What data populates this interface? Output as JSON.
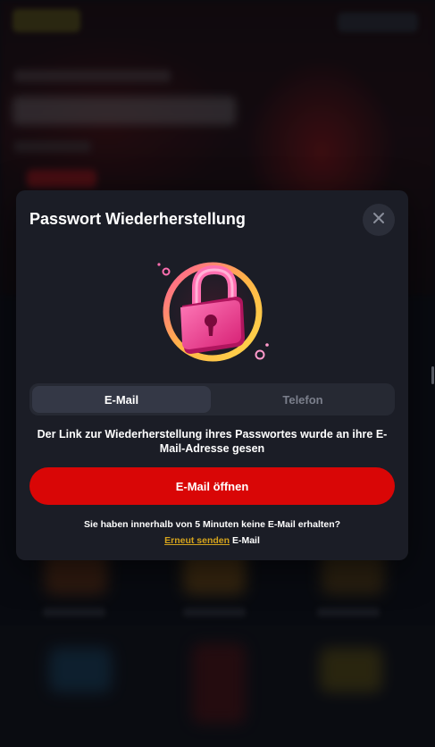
{
  "modal": {
    "title": "Passwort Wiederherstellung",
    "tabs": [
      {
        "label": "E-Mail",
        "active": true
      },
      {
        "label": "Telefon",
        "active": false
      }
    ],
    "message": "Der Link zur Wiederherstellung ihres Passwortes wurde an ihre E-Mail-Adresse gesen",
    "open_button": "E-Mail öffnen",
    "not_received": "Sie haben innerhalb von 5 Minuten keine E-Mail erhalten?",
    "resend_link": "Erneut senden",
    "resend_suffix": "E-Mail"
  },
  "icons": {
    "close": "close-icon",
    "illustration": "padlock-icon"
  },
  "colors": {
    "modal_bg": "#1b1d26",
    "primary_button": "#d90606",
    "link": "#d4a31c",
    "tab_active": "#343846",
    "tab_inactive_text": "#7b7f8c"
  }
}
